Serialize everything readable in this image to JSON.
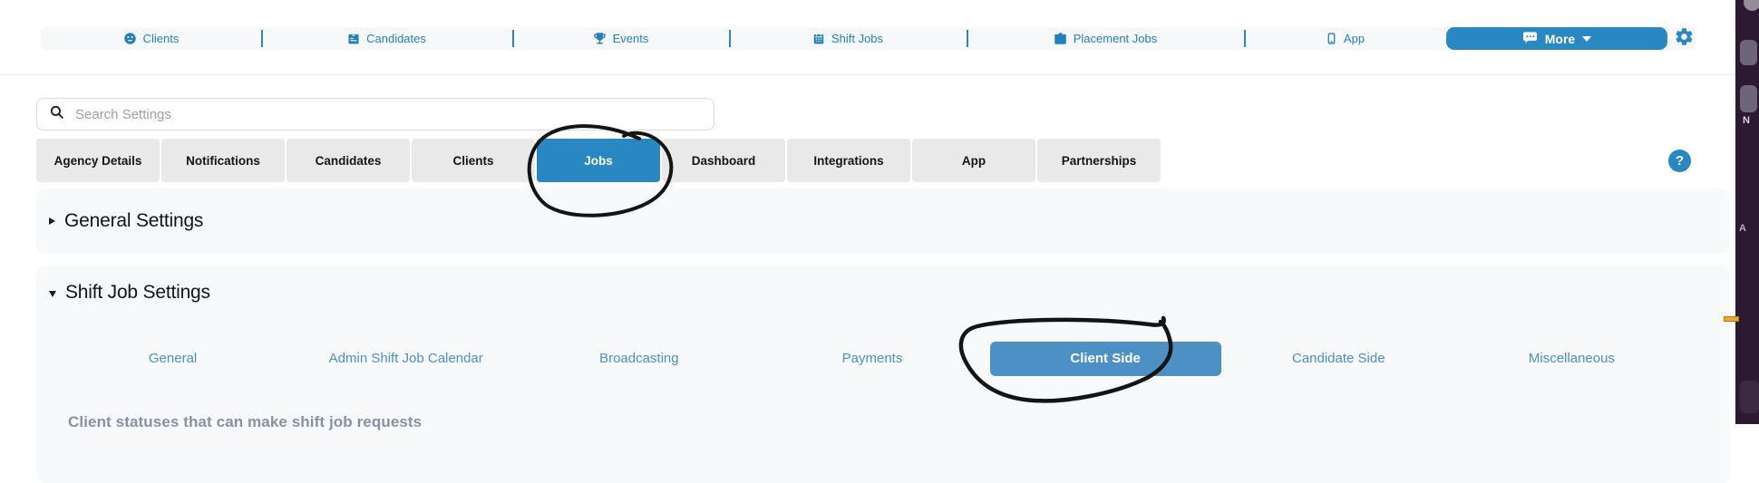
{
  "nav": {
    "items": [
      {
        "label": "Clients",
        "icon": "clients-icon"
      },
      {
        "label": "Candidates",
        "icon": "candidates-icon"
      },
      {
        "label": "Events",
        "icon": "events-icon"
      },
      {
        "label": "Shift Jobs",
        "icon": "shift-jobs-icon"
      },
      {
        "label": "Placement Jobs",
        "icon": "placement-jobs-icon"
      },
      {
        "label": "App",
        "icon": "app-icon"
      }
    ],
    "more_label": "More"
  },
  "search": {
    "placeholder": "Search Settings",
    "value": ""
  },
  "settings_tabs": {
    "items": [
      {
        "label": "Agency Details"
      },
      {
        "label": "Notifications"
      },
      {
        "label": "Candidates"
      },
      {
        "label": "Clients"
      },
      {
        "label": "Jobs"
      },
      {
        "label": "Dashboard"
      },
      {
        "label": "Integrations"
      },
      {
        "label": "App"
      },
      {
        "label": "Partnerships"
      }
    ],
    "active_label": "Jobs"
  },
  "help": {
    "label": "?"
  },
  "sections": {
    "general": {
      "title": "General Settings",
      "collapsed": true
    },
    "shift_jobs": {
      "title": "Shift Job Settings",
      "collapsed": false,
      "subtabs": [
        {
          "label": "General"
        },
        {
          "label": "Admin Shift Job Calendar"
        },
        {
          "label": "Broadcasting"
        },
        {
          "label": "Payments"
        },
        {
          "label": "Client Side"
        },
        {
          "label": "Candidate Side"
        },
        {
          "label": "Miscellaneous"
        }
      ],
      "active_subtab": "Client Side",
      "content_heading": "Client statuses that can make shift job requests"
    }
  },
  "edge_strip": {
    "letter_top": "N",
    "letter_bottom": "A"
  },
  "annotations": [
    "hand-drawn circle around Jobs tab",
    "hand-drawn circle around Client Side sub-tab"
  ],
  "colors": {
    "nav_blue": "#2580ba",
    "primary_blue": "#2987c1",
    "soft_blue": "#4d90c5",
    "tab_gray": "#e9e9ea",
    "panel_gray": "#f8f9fa",
    "heading_gray_blue": "#8692a4",
    "annotation_black": "#141414",
    "strip_purple": "#2b1a32",
    "orange_marker": "#f0a52e"
  }
}
